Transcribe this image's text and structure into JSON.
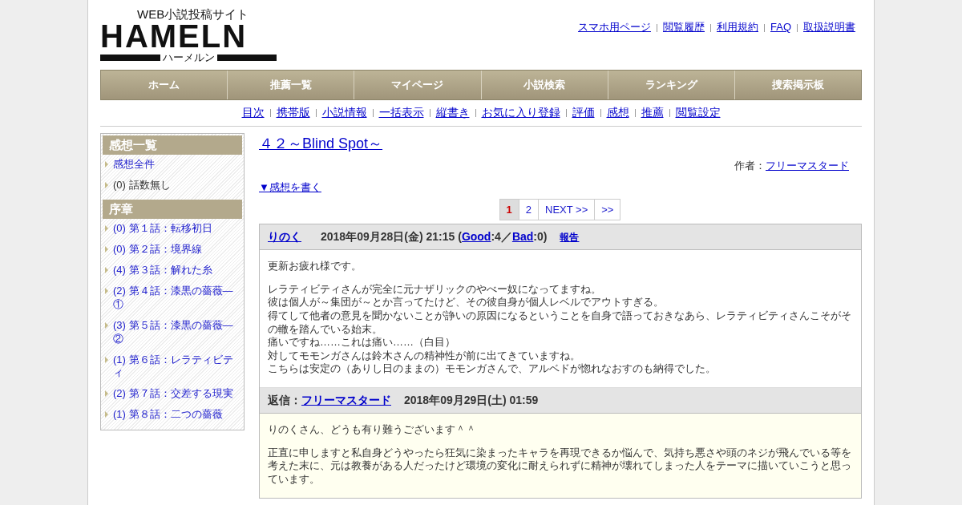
{
  "logo": {
    "tagline": "WEB小説投稿サイト",
    "name": "HAMELN",
    "kana": "ハーメルン"
  },
  "top_links": [
    "スマホ用ページ",
    "閲覧履歴",
    "利用規約",
    "FAQ",
    "取扱説明書"
  ],
  "main_nav": [
    "ホーム",
    "推薦一覧",
    "マイページ",
    "小説検索",
    "ランキング",
    "捜索掲示板"
  ],
  "sub_nav": [
    "目次",
    "携帯版",
    "小説情報",
    "一括表示",
    "縦書き",
    "お気に入り登録",
    "評価",
    "感想",
    "推薦",
    "閲覧設定"
  ],
  "sidebar": {
    "sections": [
      {
        "title": "感想一覧",
        "items": [
          {
            "label": "感想全件",
            "kind": "link"
          },
          {
            "label": "(0) 話数無し",
            "kind": "plain"
          }
        ]
      },
      {
        "title": "序章",
        "items": [
          {
            "label": "(0) 第１話：転移初日",
            "kind": "link"
          },
          {
            "label": "(0) 第２話：境界線",
            "kind": "link"
          },
          {
            "label": "(4) 第３話：解れた糸",
            "kind": "link"
          },
          {
            "label": "(2) 第４話：漆黒の薔薇—①",
            "kind": "link"
          },
          {
            "label": "(3) 第５話：漆黒の薔薇—②",
            "kind": "link"
          },
          {
            "label": "(1) 第６話：レラティビティ",
            "kind": "link"
          },
          {
            "label": "(2) 第７話：交差する現実",
            "kind": "link"
          },
          {
            "label": "(1) 第８話：二つの薔薇",
            "kind": "link"
          }
        ]
      }
    ]
  },
  "title": "４２～Blind Spot～",
  "author": {
    "label": "作者：",
    "name": "フリーマスタード"
  },
  "write_link": "▼感想を書く",
  "pagination": [
    {
      "label": "1",
      "selected": true
    },
    {
      "label": "2",
      "selected": false
    },
    {
      "label": "NEXT >>",
      "selected": false
    },
    {
      "label": ">>",
      "selected": false
    }
  ],
  "comment": {
    "author": "りのく",
    "date": "2018年09月28日(金) 21:15 (",
    "good_label": "Good",
    "good_count": ":4／",
    "bad_label": "Bad",
    "bad_count": ":0)",
    "report": "報告",
    "paragraphs": [
      [
        "更新お疲れ様です。"
      ],
      [
        "レラティビティさんが完全に元ナザリックのやべー奴になってますね。",
        "彼は個人が～集団が～とか言ってたけど、その彼自身が個人レベルでアウトすぎる。",
        "得てして他者の意見を聞かないことが諍いの原因になるということを自身で語っておきなあら、レラティビティさんこそがその轍を踏んでいる始末。",
        "痛いですね……これは痛い……（白目）",
        "対してモモンガさんは鈴木さんの精神性が前に出てきていますね。",
        "こちらは安定の（ありし日のままの）モモンガさんで、アルベドが惚れなおすのも納得でした。"
      ]
    ]
  },
  "reply": {
    "label": "返信：",
    "author": "フリーマスタード",
    "date": "2018年09月29日(土) 01:59",
    "paragraphs": [
      [
        "りのくさん、どうも有り難うございます＾＾"
      ],
      [
        "正直に申しますと私自身どうやったら狂気に染まったキャラを再現できるか悩んで、気持ち悪さや頭のネジが飛んでいる等を考えた末に、元は教養がある人だったけど環境の変化に耐えられずに精神が壊れてしまった人をテーマに描いていこうと思っています。"
      ]
    ]
  }
}
